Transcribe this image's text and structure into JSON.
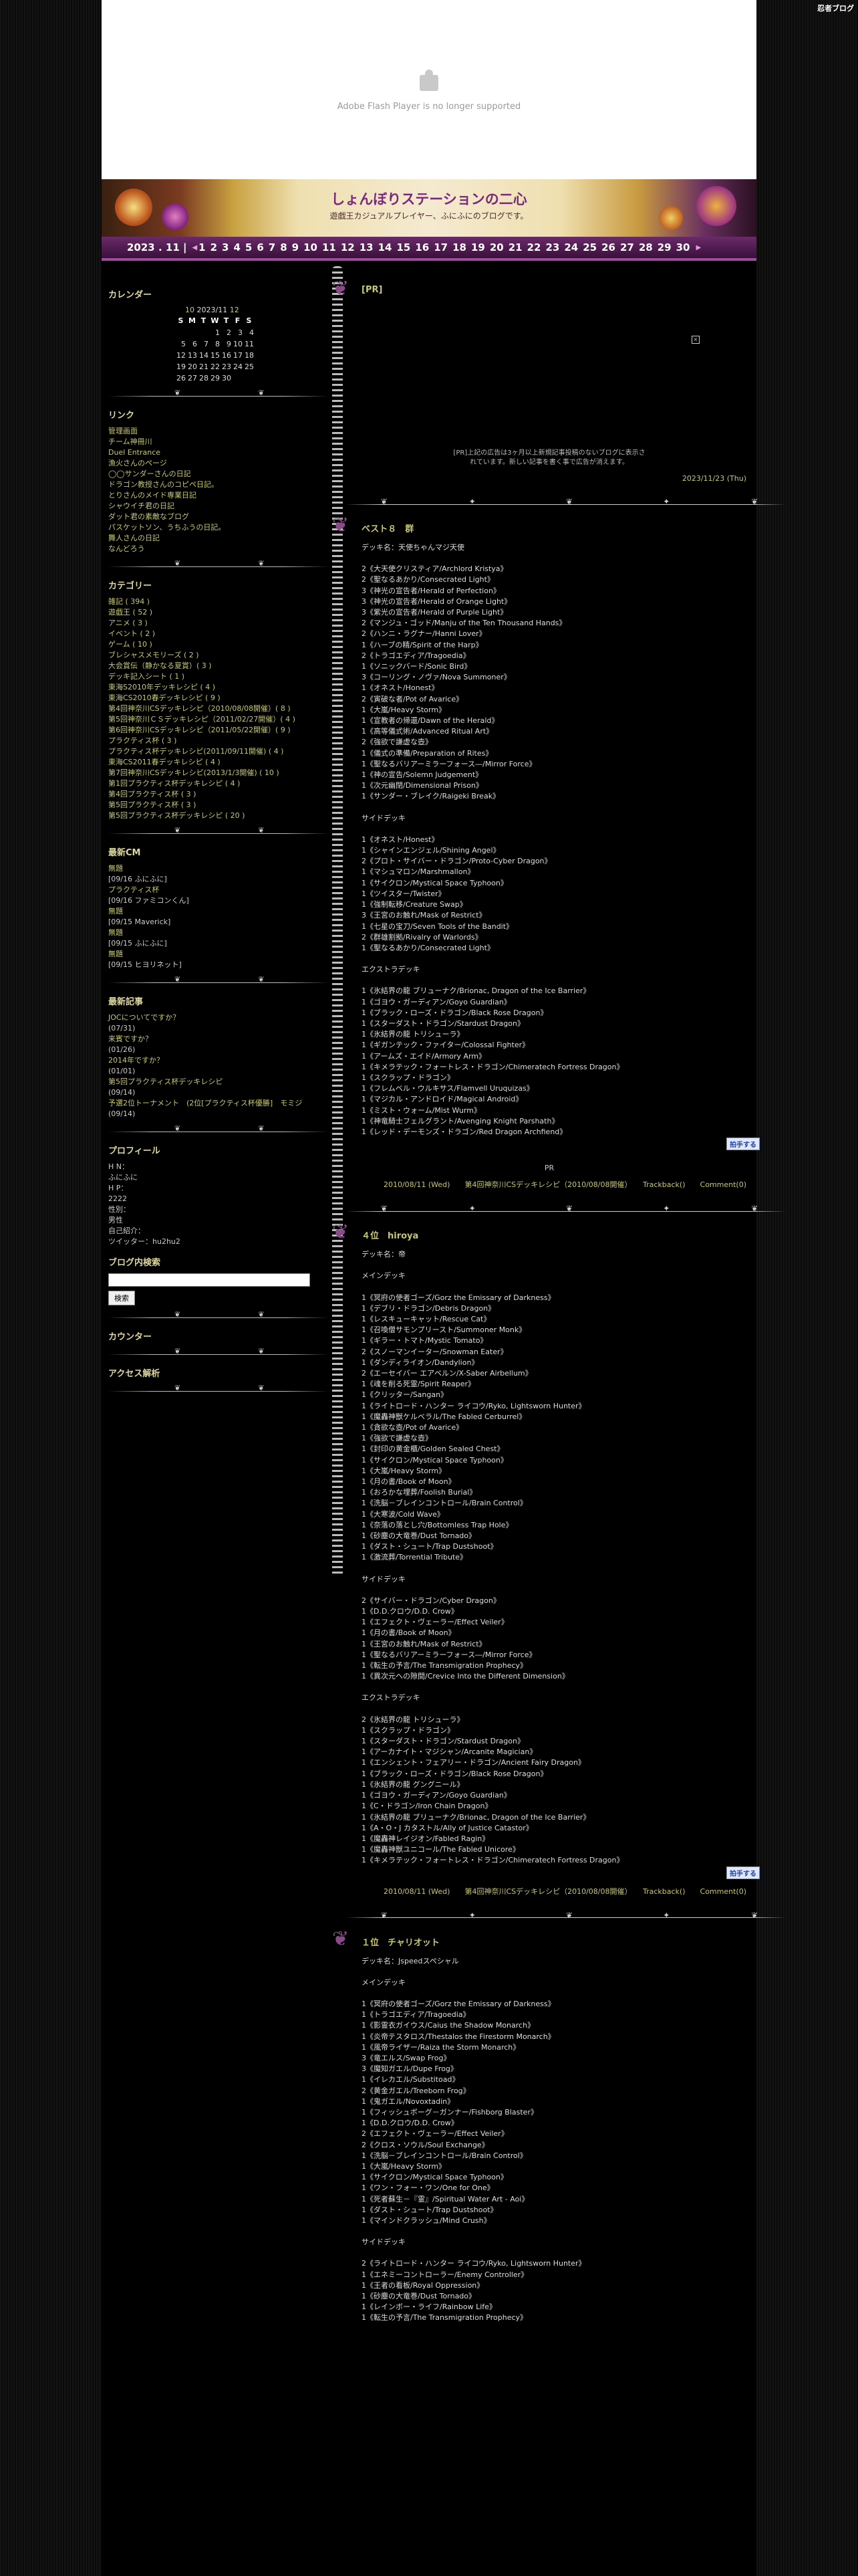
{
  "badge": "忍者ブログ",
  "flash": {
    "message": "Adobe Flash Player is no longer supported"
  },
  "header": {
    "title": "しょんぼりステーションの二心",
    "subtitle": "遊戯王カジュアルプレイヤー、ふにふにのブログです。"
  },
  "datebar": {
    "prefix": "2023 . 11 |",
    "days": [
      "1",
      "2",
      "3",
      "4",
      "5",
      "6",
      "7",
      "8",
      "9",
      "10",
      "11",
      "12",
      "13",
      "14",
      "15",
      "16",
      "17",
      "18",
      "19",
      "20",
      "21",
      "22",
      "23",
      "24",
      "25",
      "26",
      "27",
      "28",
      "29",
      "30"
    ]
  },
  "sidebar": {
    "calendar": {
      "heading": "カレンダー",
      "prev": "10",
      "current": "2023/11",
      "next": "12",
      "weekdays": [
        "S",
        "M",
        "T",
        "W",
        "T",
        "F",
        "S"
      ],
      "rows": [
        [
          "",
          "",
          "",
          "1",
          "2",
          "3",
          "4"
        ],
        [
          "5",
          "6",
          "7",
          "8",
          "9",
          "10",
          "11"
        ],
        [
          "12",
          "13",
          "14",
          "15",
          "16",
          "17",
          "18"
        ],
        [
          "19",
          "20",
          "21",
          "22",
          "23",
          "24",
          "25"
        ],
        [
          "26",
          "27",
          "28",
          "29",
          "30",
          "",
          ""
        ]
      ]
    },
    "links": {
      "heading": "リンク",
      "items": [
        "管理画面",
        "チーム神冊川",
        "Duel Entrance",
        "漁火さんのページ",
        "◯◯サンダーさんの日記",
        "ドラゴン教授さんのコピペ日記。",
        "とりさんのメイド専業日記",
        "シャウイチ君の日記",
        "ダット君の素敵なブログ",
        "パスケットソン、うちふうの日記。",
        "舞人さんの日記",
        "なんどろう"
      ]
    },
    "categories": {
      "heading": "カテゴリー",
      "items": [
        "雑記 ( 394 )",
        "遊戯王 ( 52 )",
        "アニメ ( 3 )",
        "イベント ( 2 )",
        "ゲーム ( 10 )",
        "ブレシャスメモリーズ ( 2 )",
        "大会賞伝（静かなる夏賞）( 3 )",
        "デッキ記入シート ( 1 )",
        "東海S2010年デッキレシピ ( 4 )",
        "東海CS2010春デッキレシピ ( 9 )",
        "第4回神奈川CSデッキレシピ（2010/08/08開催）( 8 )",
        "第5回神奈川ＣＳデッキレシピ（2011/02/27開催）( 4 )",
        "第6回神奈川CSデッキレシピ（2011/05/22開催）( 9 )",
        "プラクティス杯 ( 3 )",
        "プラクティス杯デッキレシピ(2011/09/11開催) ( 4 )",
        "東海CS2011春デッキレシピ ( 4 )",
        "第7回神奈川CSデッキレシピ(2013/1/3開催) ( 10 )",
        "第1回プラクティス杯デッキレシピ ( 4 )",
        "第4回プラクティス杯 ( 3 )",
        "第5回プラクティス杯 ( 3 )",
        "第5回プラクティス杯デッキレシピ ( 20 )"
      ]
    },
    "comments": {
      "heading": "最新CM",
      "items": [
        "無題",
        "[09/16 ふにふに]",
        "プラクティス杯",
        "[09/16 ファミコンくん]",
        "無題",
        "[09/15 Maverick]",
        "無題",
        "[09/15 ふにふに]",
        "無題",
        "[09/15 ヒヨリネット]"
      ]
    },
    "recent": {
      "heading": "最新記事",
      "items": [
        "JOCについてですか？",
        "(07/31)",
        "来賓ですか？",
        "(01/26)",
        "2014年ですか？",
        "(01/01)",
        "第5回プラクティス杯デッキレシピ",
        "(09/14)",
        "予選2位トーナメント　(2位[プラクティス杯優勝]　モミジ",
        "(09/14)"
      ]
    },
    "profile": {
      "heading": "プロフィール",
      "items": [
        "H N：",
        "ふにふに",
        "H P：",
        "2222",
        "性別：",
        "男性",
        "自己紹介：",
        "ツイッター：hu2hu2"
      ]
    },
    "search": {
      "heading": "ブログ内検索",
      "button": "検索"
    },
    "counter": {
      "heading": "カウンター"
    },
    "analytics": {
      "heading": "アクセス解析"
    }
  },
  "main": {
    "pr_post": {
      "title": "[PR]",
      "note_line1": "[PR]上記の広告は3ヶ月以上新規記事投稿のないブログに表示さ",
      "note_line2": "れています。新しい記事を書く事で広告が消えます。",
      "date": "2023/11/23 (Thu)"
    },
    "posts": [
      {
        "title": "ベスト８　群",
        "lines": [
          "デッキ名：天使ちゃんマジ天使",
          "",
          "2《大天使クリスティア/Archlord Kristya》",
          "2《聖なるあかり/Consecrated Light》",
          "3《神光の宣告者/Herald of Perfection》",
          "3《神光の宣告者/Herald of Orange Light》",
          "3《紫光の宣告者/Herald of Purple Light》",
          "2《マンジュ・ゴッド/Manju of the Ten Thousand Hands》",
          "2《ハンニ・ラグナー/Hanni Lover》",
          "1《ハーブの精/Spirit of the Harp》",
          "2《トラゴエディア/Tragoedia》",
          "1《ソニックバード/Sonic Bird》",
          "3《コーリング・ノヴァ/Nova Summoner》",
          "1《オネスト/Honest》",
          "2《寅破な者/Pot of Avarice》",
          "1《大嵐/Heavy Storm》",
          "1《宣教者の帰還/Dawn of the Herald》",
          "1《高等儀式術/Advanced Ritual Art》",
          "2《強欲で謙虚な壺》",
          "1《儀式の準備/Preparation of Rites》",
          "1《聖なるバリアーミラーフォース―/Mirror Force》",
          "1《神の宣告/Solemn Judgement》",
          "1《次元幽閉/Dimensional Prison》",
          "1《サンダー・ブレイク/Raigeki Break》",
          "",
          "サイドデッキ",
          "",
          "1《オネスト/Honest》",
          "1《シャインエンジェル/Shining Angel》",
          "2《プロト・サイバー・ドラゴン/Proto-Cyber Dragon》",
          "1《マシュマロン/Marshmallon》",
          "1《サイクロン/Mystical Space Typhoon》",
          "1《ツイスター/Twister》",
          "1《強制転移/Creature Swap》",
          "3《王宮のお触れ/Mask of Restrict》",
          "1《七星の宝刀/Seven Tools of the Bandit》",
          "2《群雄割拠/Rivalry of Warlords》",
          "1《聖なるあかり/Consecrated Light》",
          "",
          "エクストラデッキ",
          "",
          "1《氷結界の龍 ブリューナク/Brionac, Dragon of the Ice Barrier》",
          "1《ゴヨウ・ガーディアン/Goyo Guardian》",
          "1《ブラック・ローズ・ドラゴン/Black Rose Dragon》",
          "1《スターダスト・ドラゴン/Stardust Dragon》",
          "1《氷結界の龍 トリシューラ》",
          "1《ギガンテック・ファイター/Colossal Fighter》",
          "1《アームズ・エイド/Armory Arm》",
          "1《キメラテック・フォートレス・ドラゴン/Chimeratech Fortress Dragon》",
          "1《スクラップ・ドラゴン》",
          "1《フレムベル・ウルキサス/Flamvell Uruquizas》",
          "1《マジカル・アンドロイド/Magical Android》",
          "1《ミスト・ウォーム/Mist Wurm》",
          "1《神竜騎士フェルグラント/Avenging Knight Parshath》",
          "1《レッド・デーモンズ・ドラゴン/Red Dragon Archfiend》"
        ],
        "pr": "PR",
        "footer": "2010/08/11 (Wed)　　第4回神奈川CSデッキレシピ（2010/08/08開催）　　Trackback()　　Comment(0)"
      },
      {
        "title": "４位　hiroya",
        "lines": [
          "デッキ名：帝",
          "",
          "メインデッキ",
          "",
          "1《冥府の使者ゴーズ/Gorz the Emissary of Darkness》",
          "1《デブリ・ドラゴン/Debris Dragon》",
          "1《レスキューキャット/Rescue Cat》",
          "1《召喚僧サモンプリースト/Summoner Monk》",
          "1《ギラー・トマト/Mystic Tomato》",
          "2《スノーマンイーター/Snowman Eater》",
          "1《ダンディライオン/Dandylion》",
          "2《エーセイバー エアベルン/X-Saber Airbellum》",
          "1《魂を削る死霊/Spirit Reaper》",
          "1《クリッター/Sangan》",
          "1《ライトロード・ハンター ライコウ/Ryko, Lightsworn Hunter》",
          "1《魔轟神獣ケルベラル/The Fabled Cerburrel》",
          "1《貪欲な壺/Pot of Avarice》",
          "1《強欲で謙虚な壺》",
          "1《封印の黄金櫃/Golden Sealed Chest》",
          "1《サイクロン/Mystical Space Typhoon》",
          "1《大嵐/Heavy Storm》",
          "1《月の書/Book of Moon》",
          "1《おろかな埋葬/Foolish Burial》",
          "1《洗脳－ブレインコントロール/Brain Control》",
          "1《大寒波/Cold Wave》",
          "1《奈落の落とし穴/Bottomless Trap Hole》",
          "1《砂塵の大竜巻/Dust Tornado》",
          "1《ダスト・シュート/Trap Dustshoot》",
          "1《激流葬/Torrential Tribute》",
          "",
          "サイドデッキ",
          "",
          "2《サイバー・ドラゴン/Cyber Dragon》",
          "1《D.D.クロウ/D.D. Crow》",
          "1《エフェクト・ヴェーラー/Effect Veiler》",
          "1《月の書/Book of Moon》",
          "1《王宮のお触れ/Mask of Restrict》",
          "1《聖なるバリアーミラーフォース―/Mirror Force》",
          "1《転生の予言/The Transmigration Prophecy》",
          "1《異次元への隙間/Crevice Into the Different Dimension》",
          "",
          "エクストラデッキ",
          "",
          "2《氷結界の龍 トリシューラ》",
          "1《スクラップ・ドラゴン》",
          "1《スターダスト・ドラゴン/Stardust Dragon》",
          "1《アーカナイト・マジシャン/Arcanite Magician》",
          "1《エンシェント・フェアリー・ドラゴン/Ancient Fairy Dragon》",
          "1《ブラック・ローズ・ドラゴン/Black Rose Dragon》",
          "1《氷結界の龍 グングニール》",
          "1《ゴヨウ・ガーディアン/Goyo Guardian》",
          "1《C・ドラゴン/Iron Chain Dragon》",
          "1《氷結界の龍 ブリューナク/Brionac, Dragon of the Ice Barrier》",
          "1《A・O・J カタストル/Ally of Justice Catastor》",
          "1《魔轟神レイジオン/Fabled Ragin》",
          "1《魔轟神獣ユニコール/The Fabled Unicore》",
          "1《キメラテック・フォートレス・ドラゴン/Chimeratech Fortress Dragon》"
        ],
        "footer": "2010/08/11 (Wed)　　第4回神奈川CSデッキレシピ（2010/08/08開催）　　Trackback()　　Comment(0)"
      },
      {
        "title": "１位　チャリオット",
        "lines": [
          "デッキ名：Jspeedスペシャル",
          "",
          "メインデッキ",
          "",
          "1《冥府の使者ゴーズ/Gorz the Emissary of Darkness》",
          "1《トラゴエディア/Tragoedia》",
          "1《影霊衣ガイウス/Caius the Shadow Monarch》",
          "1《炎帝テスタロス/Thestalos the Firestorm Monarch》",
          "1《風帝ライザー/Raiza the Storm Monarch》",
          "3《竜エルス/Swap Frog》",
          "3《魔知ガエル/Dupe Frog》",
          "1《イレカエル/Substitoad》",
          "2《黄金ガエル/Treeborn Frog》",
          "1《鬼ガエル/Novoxtadin》",
          "1《フィッシュボーグ－ガンナー/Fishborg Blaster》",
          "1《D.D.クロウ/D.D. Crow》",
          "2《エフェクト・ヴェーラー/Effect Veiler》",
          "2《クロス・ソウル/Soul Exchange》",
          "1《洗脳－ブレインコントロール/Brain Control》",
          "1《大嵐/Heavy Storm》",
          "1《サイクロン/Mystical Space Typhoon》",
          "1《ワン・フォー・ワン/One for One》",
          "1《死者蘇生－『霊』/Spiritual Water Art - Aoi》",
          "1《ダスト・シュート/Trap Dustshoot》",
          "1《マインドクラッシュ/Mind Crush》",
          "",
          "サイドデッキ",
          "",
          "2《ライトロード・ハンター ライコウ/Ryko, Lightsworn Hunter》",
          "1《エネミーコントローラー/Enemy Controller》",
          "1《王者の看板/Royal Oppression》",
          "1《砂塵の大竜巻/Dust Tornado》",
          "1《レインボー・ライフ/Rainbow Life》",
          "1《転生の予言/The Transmigration Prophecy》"
        ],
        "footer": ""
      }
    ],
    "clap": "拍手する"
  }
}
